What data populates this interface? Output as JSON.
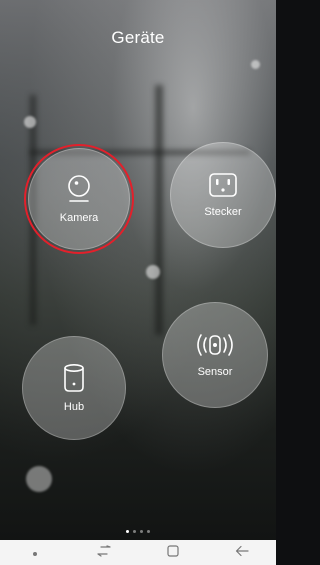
{
  "header": {
    "title": "Geräte"
  },
  "devices": [
    {
      "id": "kamera",
      "label": "Kamera",
      "icon": "camera-icon",
      "selected": true
    },
    {
      "id": "stecker",
      "label": "Stecker",
      "icon": "plug-socket-icon",
      "selected": false
    },
    {
      "id": "sensor",
      "label": "Sensor",
      "icon": "sensor-signal-icon",
      "selected": false
    },
    {
      "id": "hub",
      "label": "Hub",
      "icon": "hub-icon",
      "selected": false
    }
  ],
  "pager": {
    "pages": 4,
    "active_page": 1
  },
  "colors": {
    "selection_ring": "#e3202b",
    "bubble": "rgba(255,255,255,0.28)",
    "navbar": "#f4f4f4"
  },
  "navigation_bar": {
    "buttons": [
      "dot-icon",
      "recent-apps-icon",
      "home-icon",
      "back-icon"
    ]
  }
}
